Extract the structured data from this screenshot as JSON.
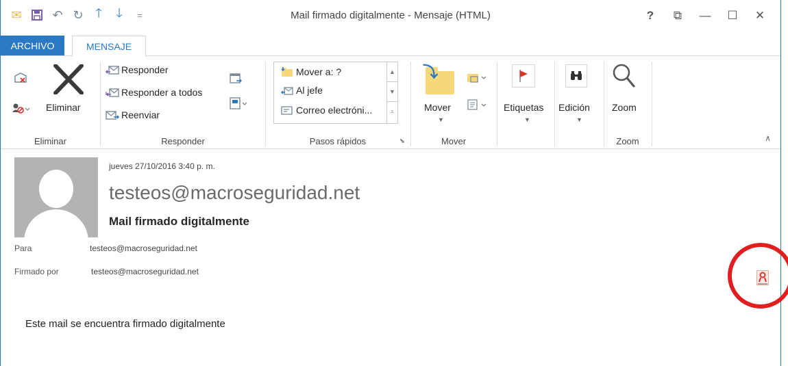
{
  "window": {
    "title": "Mail firmado digitalmente - Mensaje (HTML)",
    "controls": [
      "?",
      "⧉",
      "—",
      "☐",
      "✕"
    ]
  },
  "quick_access": [
    {
      "icon": "envelope-icon",
      "glyph": "✉"
    },
    {
      "icon": "save-icon",
      "glyph": "🖫"
    },
    {
      "icon": "undo-icon",
      "glyph": "↶"
    },
    {
      "icon": "redo-icon",
      "glyph": "↻"
    },
    {
      "icon": "up-arrow-icon",
      "glyph": "↑"
    },
    {
      "icon": "down-arrow-icon",
      "glyph": "↓"
    },
    {
      "icon": "customize-icon",
      "glyph": "="
    }
  ],
  "tabs": {
    "file": "ARCHIVO",
    "message": "MENSAJE"
  },
  "ribbon": {
    "eliminar": {
      "button": "Eliminar",
      "group": "Eliminar"
    },
    "responder": {
      "reply": "Responder",
      "reply_all": "Responder a todos",
      "forward": "Reenviar",
      "group": "Responder"
    },
    "pasos_rapidos": {
      "items": [
        "Mover a: ?",
        "Al jefe",
        "Correo electróni..."
      ],
      "group": "Pasos rápidos"
    },
    "mover": {
      "button": "Mover",
      "group": "Mover"
    },
    "etiquetas": {
      "button": "Etiquetas"
    },
    "edicion": {
      "button": "Edición"
    },
    "zoom": {
      "button": "Zoom",
      "group": "Zoom"
    }
  },
  "message": {
    "date": "jueves 27/10/2016 3:40 p. m.",
    "from": "testeos@macroseguridad.net",
    "subject": "Mail firmado digitalmente",
    "to_label": "Para",
    "to_value": "testeos@macroseguridad.net",
    "signed_label": "Firmado por",
    "signed_value": "testeos@macroseguridad.net",
    "body": "Este mail se encuentra firmado digitalmente"
  },
  "colors": {
    "accent": "#2b79c2",
    "highlight_ring": "#e02020",
    "flag": "#d9342b"
  }
}
